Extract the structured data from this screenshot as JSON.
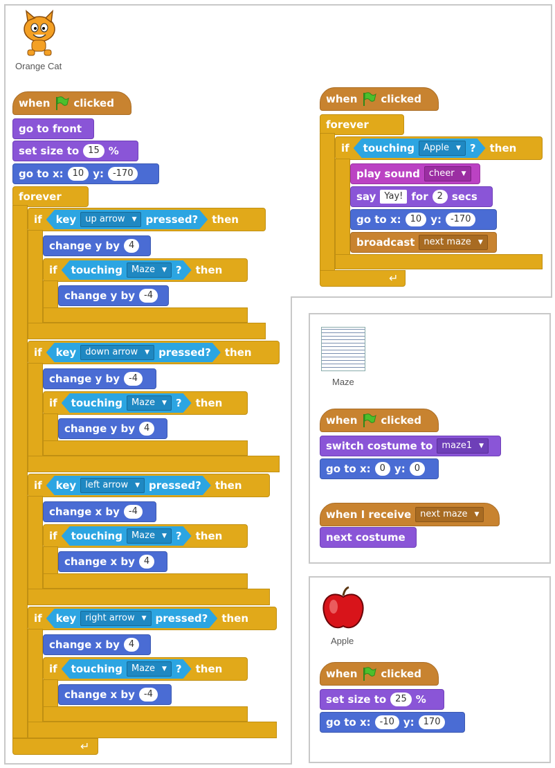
{
  "sprites": {
    "cat": {
      "name": "Orange Cat"
    },
    "maze": {
      "name": "Maze"
    },
    "apple": {
      "name": "Apple"
    }
  },
  "labels": {
    "when": "when",
    "clicked": "clicked",
    "go_to_front": "go to front",
    "set_size_to": "set size to",
    "percent": "%",
    "go_to_x": "go to x:",
    "y": "y:",
    "forever": "forever",
    "if": "if",
    "then": "then",
    "key": "key",
    "pressed": "pressed?",
    "change_y_by": "change y by",
    "change_x_by": "change x by",
    "touching": "touching",
    "q": "?",
    "play_sound": "play sound",
    "say": "say",
    "for": "for",
    "secs": "secs",
    "broadcast": "broadcast",
    "switch_costume_to": "switch costume to",
    "when_i_receive": "when I receive",
    "next_costume": "next costume"
  },
  "cat_script": {
    "size": "15",
    "start_x": "10",
    "start_y": "-170",
    "keys": [
      "up arrow",
      "down arrow",
      "left arrow",
      "right arrow"
    ],
    "moves": [
      "4",
      "-4",
      "-4",
      "4",
      "-4",
      "4",
      "4",
      "-4"
    ],
    "touch_target": "Maze"
  },
  "cat_script2": {
    "touch_target": "Apple",
    "sound": "cheer",
    "say_text": "Yay!",
    "say_secs": "2",
    "x": "10",
    "y": "-170",
    "message": "next maze"
  },
  "maze_script": {
    "costume": "maze1",
    "x": "0",
    "y": "0",
    "message": "next maze"
  },
  "apple_script": {
    "size": "25",
    "x": "-10",
    "y": "170"
  },
  "colors": {
    "motion": "#4a6cd4",
    "looks": "#8a55d7",
    "sound": "#bb42c3",
    "events": "#c88330",
    "control": "#e1a91a",
    "sensing": "#2ca5e2"
  }
}
